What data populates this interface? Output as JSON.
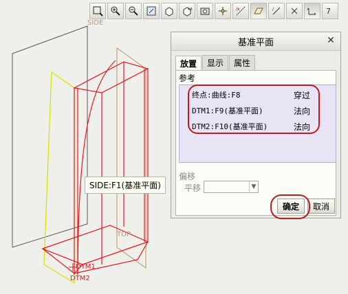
{
  "toolbar": {
    "icons": [
      "zoom-window-icon",
      "zoom-in-icon",
      "zoom-out-icon",
      "refit-icon",
      "orient-icon",
      "saved-views-icon",
      "repaint-icon",
      "spin-center-icon",
      "datum-axes-icon",
      "datum-planes-icon",
      "axis-display-icon",
      "point-display-icon",
      "coord-sys-icon",
      "layers-icon"
    ]
  },
  "canvas": {
    "labels": {
      "side": "SIDE",
      "top": "TOP",
      "dtm1": "DTM1",
      "dtm2": "DTM2"
    }
  },
  "tooltip": {
    "text": "SIDE:F1(基准平面)"
  },
  "dialog": {
    "title": "基准平面",
    "tabs": [
      "放置",
      "显示",
      "属性"
    ],
    "reference_label": "参考",
    "references": [
      {
        "entity": "终点:曲线:F8",
        "constraint": "穿过"
      },
      {
        "entity": "DTM1:F9(基准平面)",
        "constraint": "法向"
      },
      {
        "entity": "DTM2:F10(基准平面)",
        "constraint": "法向"
      }
    ],
    "offset_label": "偏移",
    "translate_label": "平移",
    "translate_value": "",
    "ok_label": "确定",
    "cancel_label": "取消"
  },
  "colors": {
    "highlight": "#c01a1a",
    "ref_list_bg": "#e8e4f5",
    "red_geometry": "#e8141a",
    "yellow_plane": "#e0e000",
    "dark_plane": "#555555",
    "tan_plane": "#c0925b"
  }
}
